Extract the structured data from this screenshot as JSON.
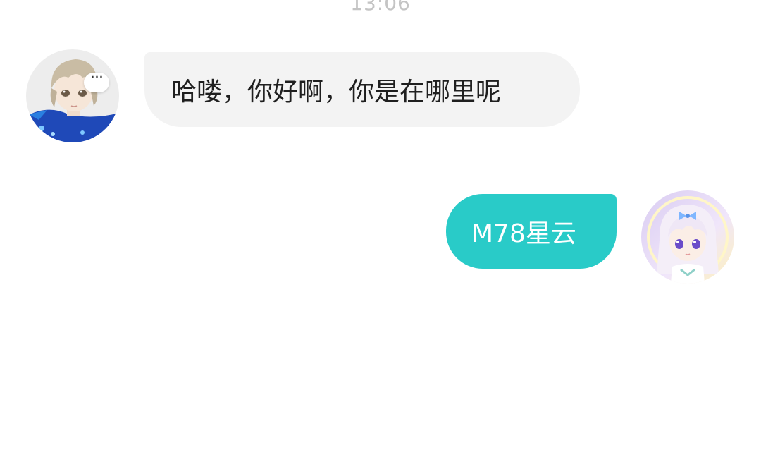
{
  "chat": {
    "timestamp": "13:06",
    "messages": [
      {
        "direction": "incoming",
        "text": "哈喽，你好啊，你是在哪里呢",
        "typing_badge": "···",
        "avatar_icon": "anime-boy-avatar"
      },
      {
        "direction": "outgoing",
        "text": "M78星云",
        "avatar_icon": "anime-girl-avatar"
      }
    ]
  },
  "colors": {
    "incoming_bubble": "#f3f3f3",
    "outgoing_bubble": "#29cbc8",
    "timestamp_text": "#c4c4c4"
  }
}
